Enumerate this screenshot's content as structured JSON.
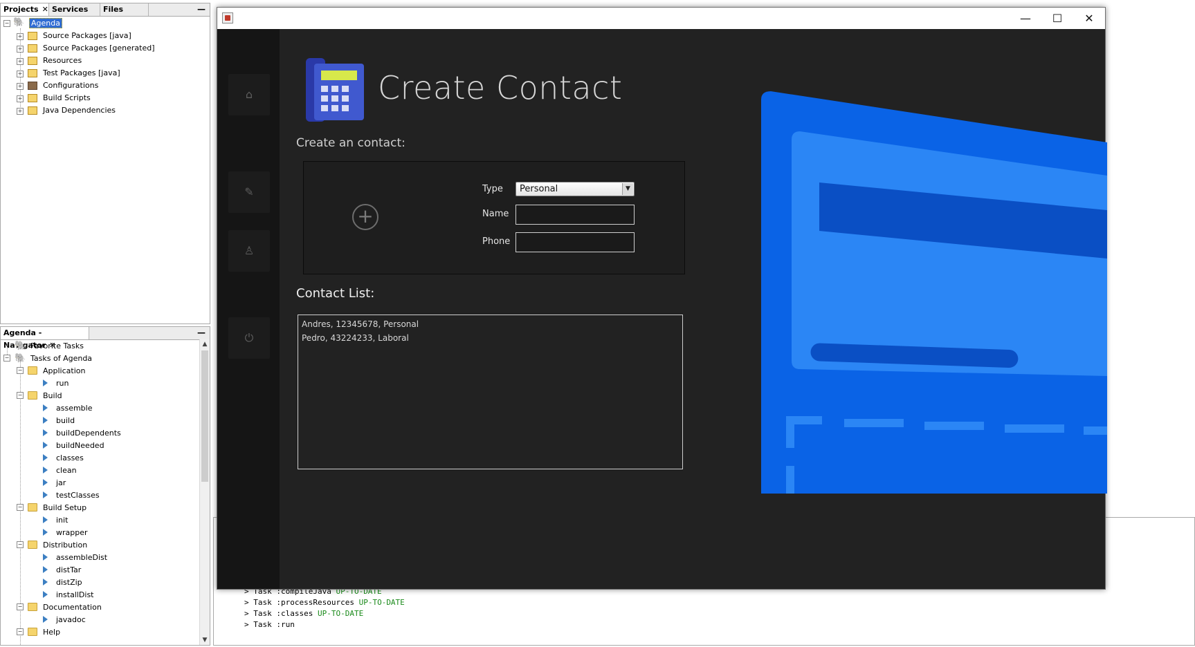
{
  "projects_panel": {
    "tabs": [
      {
        "label": "Projects",
        "close": "✕"
      },
      {
        "label": "Services"
      },
      {
        "label": "Files"
      }
    ],
    "minimize": "—",
    "tree": [
      {
        "label": "Agenda"
      },
      {
        "label": "Source Packages [java]"
      },
      {
        "label": "Source Packages [generated]"
      },
      {
        "label": "Resources"
      },
      {
        "label": "Test Packages [java]"
      },
      {
        "label": "Configurations"
      },
      {
        "label": "Build Scripts"
      },
      {
        "label": "Java Dependencies"
      }
    ]
  },
  "navigator_panel": {
    "tab": "Agenda - Navigator",
    "close": "✕",
    "minimize": "—",
    "tree": [
      {
        "label": "Favorite Tasks"
      },
      {
        "label": "Tasks of Agenda"
      },
      {
        "label": "Application"
      },
      {
        "label": "run"
      },
      {
        "label": "Build"
      },
      {
        "label": "assemble"
      },
      {
        "label": "build"
      },
      {
        "label": "buildDependents"
      },
      {
        "label": "buildNeeded"
      },
      {
        "label": "classes"
      },
      {
        "label": "clean"
      },
      {
        "label": "jar"
      },
      {
        "label": "testClasses"
      },
      {
        "label": "Build Setup"
      },
      {
        "label": "init"
      },
      {
        "label": "wrapper"
      },
      {
        "label": "Distribution"
      },
      {
        "label": "assembleDist"
      },
      {
        "label": "distTar"
      },
      {
        "label": "distZip"
      },
      {
        "label": "installDist"
      },
      {
        "label": "Documentation"
      },
      {
        "label": "javadoc"
      },
      {
        "label": "Help"
      }
    ]
  },
  "output": {
    "lines": [
      {
        "text": "> Task :compileJava ",
        "status": "UP-TO-DATE"
      },
      {
        "text": "> Task :processResources ",
        "status": "UP-TO-DATE"
      },
      {
        "text": "> Task :classes ",
        "status": "UP-TO-DATE"
      },
      {
        "text": "> Task :run",
        "status": ""
      }
    ]
  },
  "app_window": {
    "controls": {
      "minimize": "—",
      "maximize": "☐",
      "close": "✕"
    },
    "sidebar_icons": [
      "home-icon",
      "edit-icon",
      "contacts-icon",
      "power-icon"
    ],
    "title": "Create Contact",
    "subtitle": "Create an contact:",
    "form": {
      "type_label": "Type",
      "type_value": "Personal",
      "name_label": "Name",
      "name_value": "",
      "phone_label": "Phone",
      "phone_value": ""
    },
    "list_title": "Contact List:",
    "contacts": [
      "Andres, 12345678, Personal",
      "Pedro, 43224233, Laboral"
    ],
    "colors": {
      "accent_blue": "#0a63e6",
      "light_blue": "#2b86f5",
      "dark_blue": "#0a4fc4"
    }
  }
}
